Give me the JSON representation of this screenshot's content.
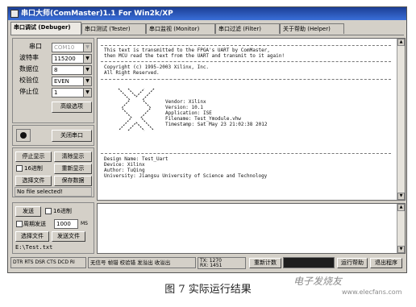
{
  "window": {
    "title": "串口大师(ComMaster)1.1 For Win2k/XP"
  },
  "tabs": [
    {
      "label": "串口调试 (Debuger)"
    },
    {
      "label": "串口测试 (Tester)"
    },
    {
      "label": "串口监视 (Monitor)"
    },
    {
      "label": "串口过滤 (Filter)"
    },
    {
      "label": "关于帮助 (Helper)"
    }
  ],
  "settings": {
    "port_label": "串口",
    "port_value": "COM10",
    "baud_label": "波特率",
    "baud_value": "115200",
    "databits_label": "数据位",
    "databits_value": "8",
    "parity_label": "校验位",
    "parity_value": "EVEN",
    "stopbits_label": "停止位",
    "stopbits_value": "1",
    "advanced_button": "高级选项"
  },
  "port_control": {
    "close_button": "关闭串口"
  },
  "receive_controls": {
    "stop_display_button": "停止显示",
    "clear_display_button": "清除显示",
    "hex_checkbox_label": "16进制",
    "resend_display_button": "重新显示",
    "select_file_button": "选择文件",
    "save_data_button": "保存数据",
    "file_status": "No file selected!"
  },
  "send_controls": {
    "send_button": "发送",
    "hex_checkbox_label": "16进制",
    "periodic_label": "周期发送",
    "period_value": "1000",
    "period_unit": "MS",
    "select_file_button": "选择文件",
    "send_file_button": "发送文件",
    "file_path": "E:\\Test.txt"
  },
  "receive_text": [
    "This text is transmitted to the FPGA's UART by ComMaster,",
    "then MCU read the text from the UART and transmit to it again!",
    "Copyright (c) 1995-2003 Xilinx, Inc.",
    "All Right Reserved.",
    "Vendor: Xilinx",
    "Version: 10.1",
    "Application: ISE",
    "Filename: Test_Ymodule.vhw",
    "Timestamp: Sat May 23 21:02:38 2012",
    "Design Name: Test_Uart",
    "Device: Xilinx",
    "Author: TuQing",
    "University: Jiangsu University of Science and Technology"
  ],
  "status_bar": {
    "signals": "DTR RTS DSR CTS DCD RI",
    "indicators": "无信号 帧错 校验错 发溢出 收溢出",
    "tx_label": "TX:",
    "tx_value": "1270",
    "rx_label": "RX:",
    "rx_value": "1451",
    "recount_button": "重新计数",
    "help_button": "运行帮助",
    "exit_button": "退出程序"
  },
  "caption": "图 7  实际运行结果",
  "watermark": "电子发烧友",
  "watermark_url": "www.elecfans.com"
}
